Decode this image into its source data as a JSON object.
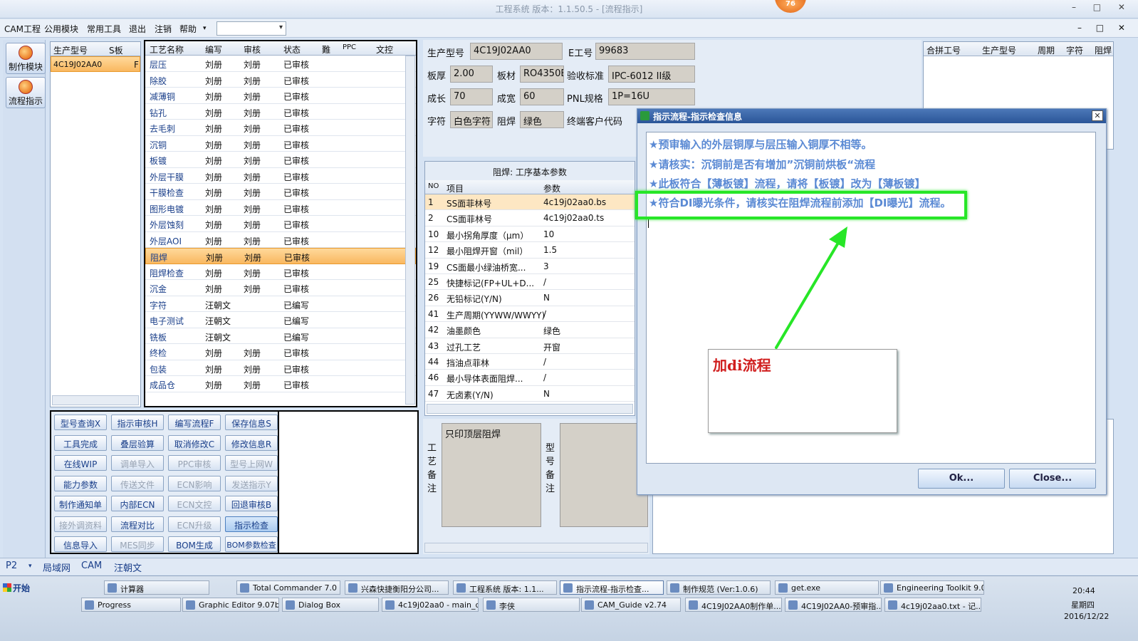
{
  "window": {
    "title": "工程系统  版本：1.1.50.5 - [流程指示]",
    "badge": "76",
    "controls": "– □ ✕"
  },
  "menu": {
    "items": [
      "CAM工程",
      "公用模块",
      "常用工具",
      "退出",
      "注销",
      "帮助"
    ],
    "mdi_controls": "– □ ✕"
  },
  "left_toolbar": [
    "制作模块",
    "流程指示"
  ],
  "job_grid": {
    "headers": [
      "生产型号",
      "S板"
    ],
    "rows": [
      {
        "model": "4C19J02AA0",
        "flag": "F"
      }
    ]
  },
  "process_grid": {
    "headers": [
      "工艺名称",
      "编写",
      "审核",
      "状态",
      "難",
      "PPC",
      "文控"
    ],
    "rows": [
      {
        "name": "层压",
        "writer": "刘册",
        "reviewer": "刘册",
        "status": "已审核"
      },
      {
        "name": "除胶",
        "writer": "刘册",
        "reviewer": "刘册",
        "status": "已审核"
      },
      {
        "name": "减薄铜",
        "writer": "刘册",
        "reviewer": "刘册",
        "status": "已审核"
      },
      {
        "name": "钻孔",
        "writer": "刘册",
        "reviewer": "刘册",
        "status": "已审核"
      },
      {
        "name": "去毛刺",
        "writer": "刘册",
        "reviewer": "刘册",
        "status": "已审核"
      },
      {
        "name": "沉铜",
        "writer": "刘册",
        "reviewer": "刘册",
        "status": "已审核"
      },
      {
        "name": "板镀",
        "writer": "刘册",
        "reviewer": "刘册",
        "status": "已审核"
      },
      {
        "name": "外层干膜",
        "writer": "刘册",
        "reviewer": "刘册",
        "status": "已审核"
      },
      {
        "name": "干膜检查",
        "writer": "刘册",
        "reviewer": "刘册",
        "status": "已审核"
      },
      {
        "name": "图形电镀",
        "writer": "刘册",
        "reviewer": "刘册",
        "status": "已审核"
      },
      {
        "name": "外层蚀刻",
        "writer": "刘册",
        "reviewer": "刘册",
        "status": "已审核"
      },
      {
        "name": "外层AOI",
        "writer": "刘册",
        "reviewer": "刘册",
        "status": "已审核"
      },
      {
        "name": "阻焊",
        "writer": "刘册",
        "reviewer": "刘册",
        "status": "已审核"
      },
      {
        "name": "阻焊检查",
        "writer": "刘册",
        "reviewer": "刘册",
        "status": "已审核"
      },
      {
        "name": "沉金",
        "writer": "刘册",
        "reviewer": "刘册",
        "status": "已审核"
      },
      {
        "name": "字符",
        "writer": "汪朝文",
        "reviewer": "",
        "status": "已编写"
      },
      {
        "name": "电子测试",
        "writer": "汪朝文",
        "reviewer": "",
        "status": "已编写"
      },
      {
        "name": "铣板",
        "writer": "汪朝文",
        "reviewer": "",
        "status": "已编写"
      },
      {
        "name": "终检",
        "writer": "刘册",
        "reviewer": "刘册",
        "status": "已审核"
      },
      {
        "name": "包装",
        "writer": "刘册",
        "reviewer": "刘册",
        "status": "已审核"
      },
      {
        "name": "成品仓",
        "writer": "刘册",
        "reviewer": "刘册",
        "status": "已审核"
      }
    ]
  },
  "buttons": [
    {
      "label": "型号查询X",
      "state": "normal"
    },
    {
      "label": "指示审核H",
      "state": "normal"
    },
    {
      "label": "编写流程F",
      "state": "normal"
    },
    {
      "label": "保存信息S",
      "state": "normal"
    },
    {
      "label": "工具完成",
      "state": "normal"
    },
    {
      "label": "叠层验算",
      "state": "normal"
    },
    {
      "label": "取消修改C",
      "state": "normal"
    },
    {
      "label": "修改信息R",
      "state": "normal"
    },
    {
      "label": "在线WIP",
      "state": "normal"
    },
    {
      "label": "调单导入",
      "state": "disabled"
    },
    {
      "label": "PPC审核",
      "state": "disabled"
    },
    {
      "label": "型号上网W",
      "state": "disabled"
    },
    {
      "label": "能力参数",
      "state": "normal"
    },
    {
      "label": "传送文件",
      "state": "disabled"
    },
    {
      "label": "ECN影响",
      "state": "disabled"
    },
    {
      "label": "发送指示Y",
      "state": "disabled"
    },
    {
      "label": "制作通知单",
      "state": "normal"
    },
    {
      "label": "内部ECN",
      "state": "normal"
    },
    {
      "label": "ECN文控",
      "state": "disabled"
    },
    {
      "label": "回退审核B",
      "state": "normal"
    },
    {
      "label": "接外调资料",
      "state": "disabled"
    },
    {
      "label": "流程对比",
      "state": "normal"
    },
    {
      "label": "ECN升级",
      "state": "disabled"
    },
    {
      "label": "指示检查",
      "state": "active"
    },
    {
      "label": "信息导入",
      "state": "normal"
    },
    {
      "label": "MES同步",
      "state": "disabled"
    },
    {
      "label": "BOM生成",
      "state": "normal"
    },
    {
      "label": "BOM参数检查",
      "state": "normal"
    }
  ],
  "info": {
    "model_label": "生产型号",
    "model_value": "4C19J02AA0",
    "e_label": "E工号",
    "e_value": "99683",
    "thickness_label": "板厚",
    "thickness_value": "2.00",
    "material_label": "板材",
    "material_value": "RO4350B",
    "accept_label": "验收标准",
    "accept_value": "IPC-6012 II级",
    "grow_label": "成长",
    "grow_value": "70",
    "width_label": "成宽",
    "width_value": "60",
    "pnl_label": "PNL规格",
    "pnl_value": "1P=16U",
    "char_label": "字符",
    "char_value": "白色字符",
    "mask_label": "阻焊",
    "mask_value": "绿色",
    "customer_label": "终端客户代码"
  },
  "merge_grid": {
    "headers": [
      "合拼工号",
      "生产型号",
      "周期",
      "字符",
      "阻焊"
    ]
  },
  "params": {
    "title": "阻焊: 工序基本参数",
    "headers": [
      "NO",
      "项目",
      "参数"
    ],
    "rows": [
      {
        "no": "1",
        "item": "SS面菲林号",
        "value": "4c19j02aa0.bs"
      },
      {
        "no": "2",
        "item": "CS面菲林号",
        "value": "4c19j02aa0.ts"
      },
      {
        "no": "10",
        "item": "最小拐角厚度（μm）",
        "value": "10"
      },
      {
        "no": "12",
        "item": "最小阻焊开窗（mil）",
        "value": "1.5"
      },
      {
        "no": "19",
        "item": "CS面最小绿油桥宽...",
        "value": "3"
      },
      {
        "no": "25",
        "item": "快捷标记(FP+UL+D...",
        "value": "/"
      },
      {
        "no": "26",
        "item": "无铅标记(Y/N)",
        "value": "N"
      },
      {
        "no": "41",
        "item": "生产周期(YYWW/WWYY)",
        "value": "/"
      },
      {
        "no": "42",
        "item": "油墨颜色",
        "value": "绿色"
      },
      {
        "no": "43",
        "item": "过孔工艺",
        "value": "开窗"
      },
      {
        "no": "44",
        "item": "挡油点菲林",
        "value": "/"
      },
      {
        "no": "46",
        "item": "最小导体表面阻焊...",
        "value": "/"
      },
      {
        "no": "47",
        "item": "无卤素(Y/N)",
        "value": "N"
      }
    ]
  },
  "remarks": {
    "process_label": [
      "工",
      "艺",
      "备",
      "注"
    ],
    "process_text": "只印顶层阻焊",
    "model_label": [
      "型",
      "号",
      "备",
      "注"
    ]
  },
  "dialog": {
    "title": "指示流程-指示检查信息",
    "messages": [
      "★预审输入的外层铜厚与层压输入铜厚不相等。",
      "★请核实：沉铜前是否有增加”沉铜前烘板“流程",
      "★此板符合【薄板镀】流程，请将【板镀】改为【薄板镀】",
      "★符合DI曝光条件，请核实在阻焊流程前添加【DI曝光】流程。"
    ],
    "ok": "Ok...",
    "close": "Close..."
  },
  "annotation": {
    "text": "加di流程",
    "arrow_color": "#27e627"
  },
  "status_tabs": [
    "P2",
    "局域网",
    "CAM",
    "汪朝文"
  ],
  "taskbar": {
    "start": "开始",
    "row1": [
      "计算器",
      "Total Commander 7.0 p...",
      "兴森快捷衡阳分公司...",
      "工程系统  版本: 1.1...",
      "指示流程-指示检查...",
      "制作规范 (Ver:1.0.6)",
      "get.exe",
      "Engineering Toolkit 9.0..."
    ],
    "row2": [
      "Progress",
      "Graphic Editor 9.07b...",
      "Dialog Box",
      "4c19j02aa0 - main_qa",
      "李侠",
      "CAM_Guide v2.74",
      "4C19J02AA0制作单...",
      "4C19J02AA0-预审指...",
      "4c19j02aa0.txt - 记..."
    ],
    "clock": "20:44",
    "weekday": "星期四",
    "date": "2016/12/22"
  }
}
